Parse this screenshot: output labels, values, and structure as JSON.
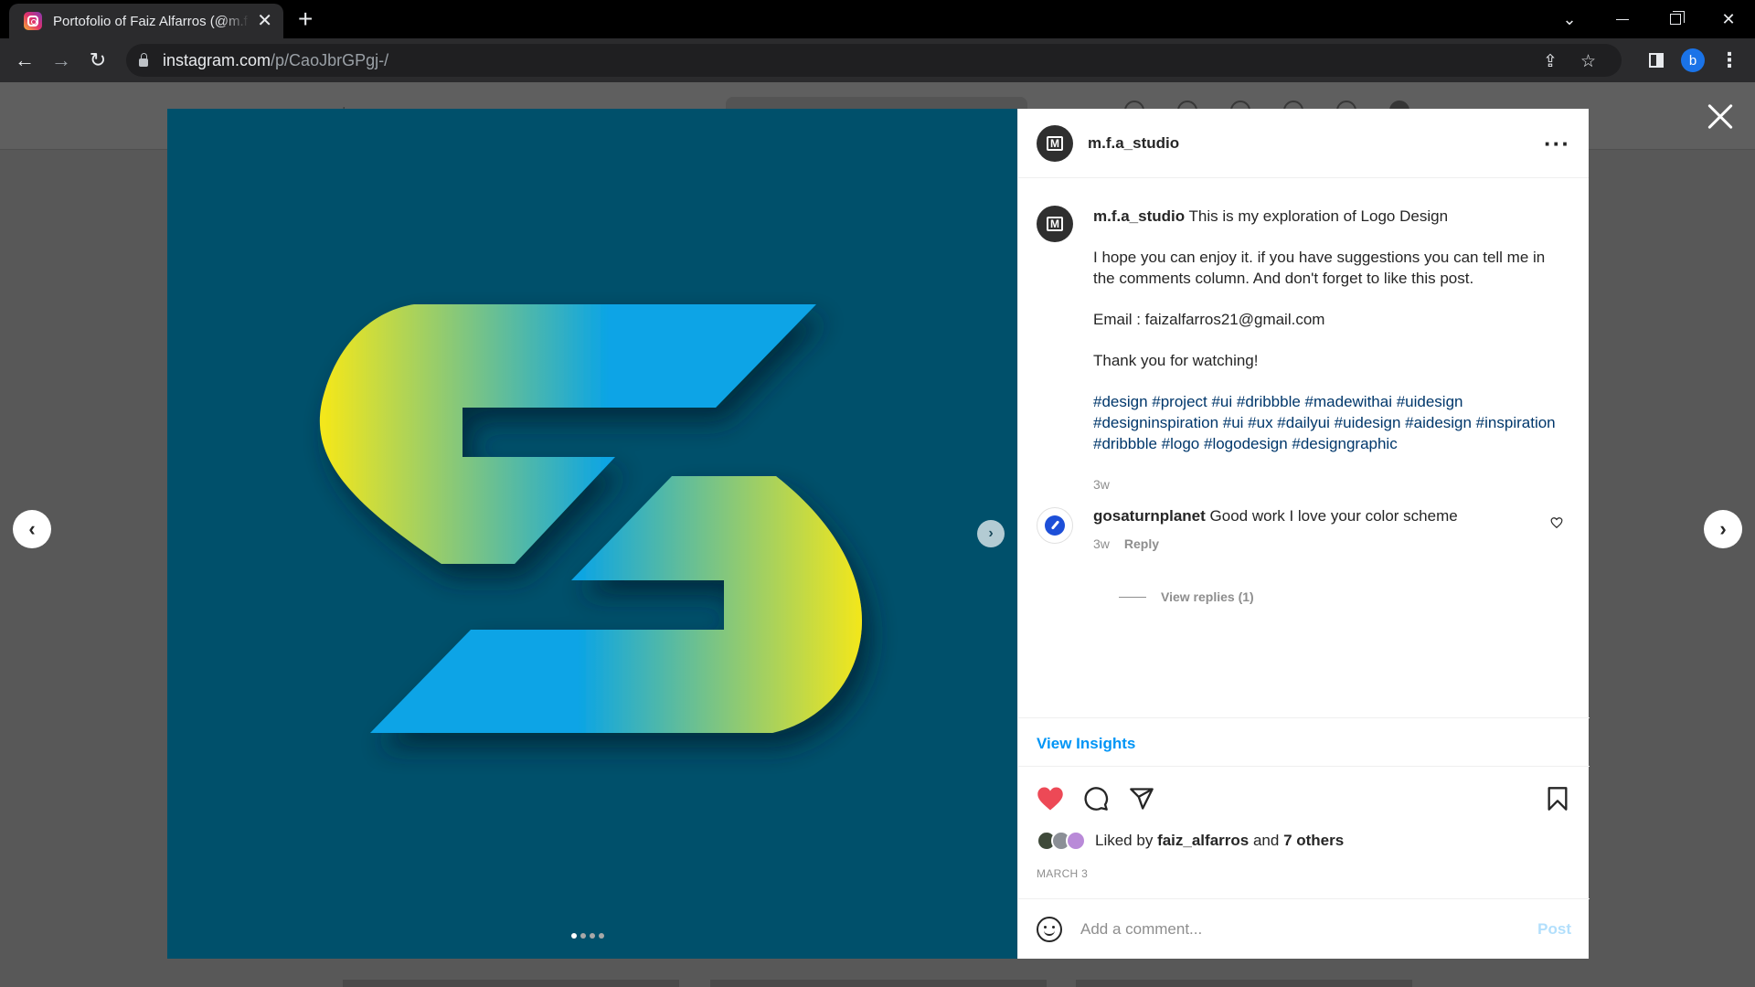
{
  "browser": {
    "tab_title": "Portofolio of Faiz Alfarros (@m.f.a_studio)",
    "new_tab": "+",
    "url_host": "instagram.com",
    "url_path": "/p/CaoJbrGPgj-/",
    "profile_initial": "b",
    "icons": [
      "instagram-favicon",
      "back-icon",
      "forward-icon",
      "reload-icon",
      "lock-icon",
      "share-icon",
      "star-icon",
      "sidebar-icon",
      "menu-icon"
    ]
  },
  "post": {
    "username": "m.f.a_studio",
    "avatar_mark": "M",
    "caption": {
      "first_line": "This is my exploration of Logo Design",
      "paragraph_2": "I hope you can enjoy it. if you have suggestions you can tell me in the comments column. And don't forget to like this post.",
      "paragraph_3": "Email : faizalfarros21@gmail.com",
      "paragraph_4": "Thank you for watching!",
      "hashtags": "#design #project #ui #dribbble #madewithai #uidesign #designinspiration #ui #ux #dailyui #uidesign #aidesign #inspiration #dribbble #logo #logodesign #designgraphic",
      "time": "3w"
    },
    "comment": {
      "username": "gosaturnplanet",
      "text": "Good work I love your color scheme",
      "time": "3w",
      "reply_label": "Reply",
      "view_replies": "View replies (1)"
    },
    "view_insights": "View Insights",
    "likes": {
      "prefix": "Liked by",
      "user": "faiz_alfarros",
      "middle": "and",
      "others": "7 others"
    },
    "date": "MARCH 3",
    "comment_placeholder": "Add a comment...",
    "post_label": "Post",
    "carousel": {
      "slide_count": 4,
      "active_index": 0
    },
    "colors": {
      "media_bg": "#00506b",
      "logo_yellow": "#f3e71b",
      "logo_blue": "#0aa4e6",
      "like_red": "#ed4956",
      "link_blue": "#0095f6"
    }
  }
}
